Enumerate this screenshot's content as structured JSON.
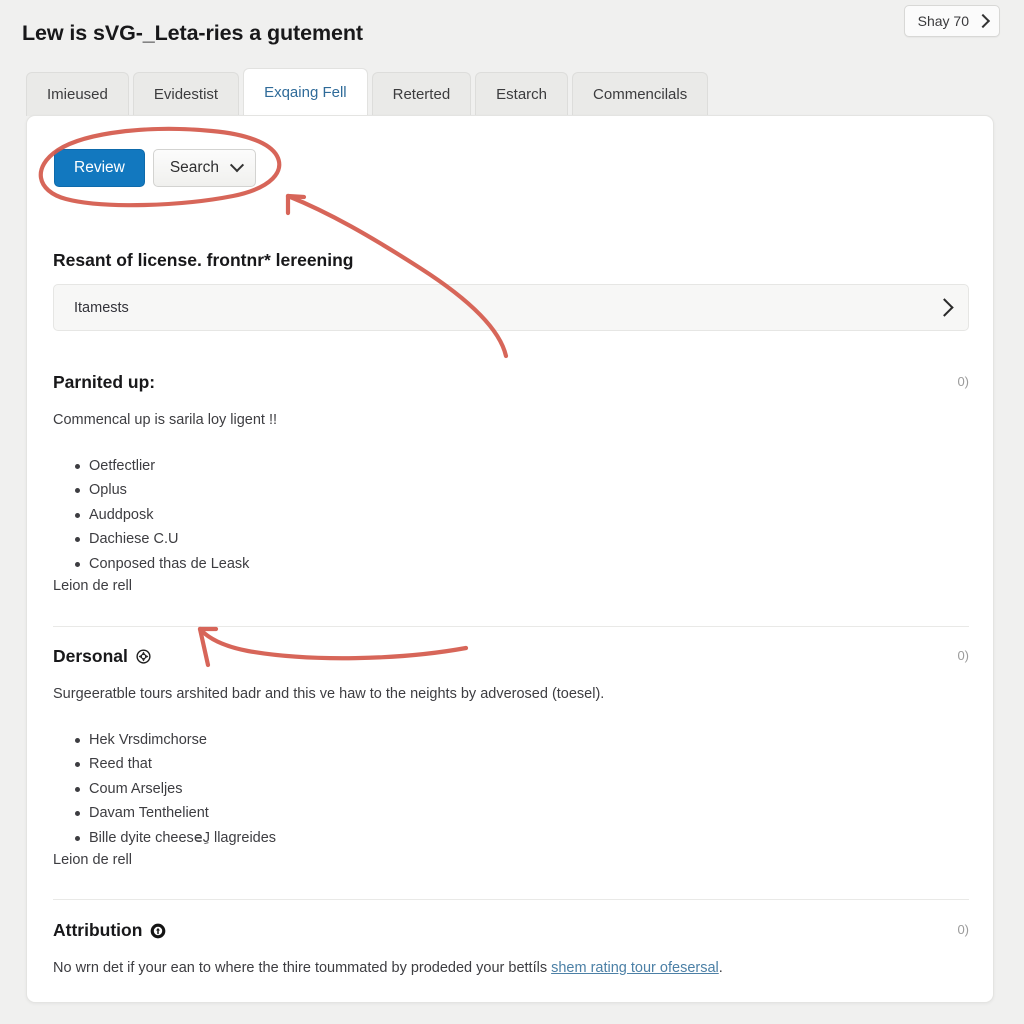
{
  "header": {
    "title": "Lew is sVG-_Leta‑ries a gutement",
    "account_button": {
      "label": "Shay 70",
      "icon": "chevron-right-icon"
    }
  },
  "tabs": [
    {
      "label": "Imieused",
      "active": false,
      "underlined": true
    },
    {
      "label": "Evidestist",
      "active": false,
      "underlined": false
    },
    {
      "label": "Exqaing Fell",
      "active": true,
      "underlined": false
    },
    {
      "label": "Reterted",
      "active": false,
      "underlined": false
    },
    {
      "label": "Estarch",
      "active": false,
      "underlined": false
    },
    {
      "label": "Commencilals",
      "active": false,
      "underlined": false
    }
  ],
  "toolbar": {
    "primary_label": "Review",
    "dropdown_label": "Search",
    "dropdown_icon": "chevron-down-icon"
  },
  "sections": {
    "results": {
      "heading": "Resant of license. frontnr* lereening",
      "row_label": "Itamests",
      "row_icon": "chevron-right-icon"
    },
    "partnered": {
      "heading": "Parnited up:",
      "count": "0)",
      "intro": "Commencal up is sarila loy ligent !!",
      "items": [
        "Oetfectlier",
        "Oplus",
        "Auddposk",
        "Dachiese C.U",
        "Conposed thas de Leask"
      ],
      "footer": "Leion de rell"
    },
    "personal": {
      "heading": "Dersonal",
      "heading_icon": "gear-icon",
      "count": "0)",
      "intro": "Surgeeratble tours arshited badr and this ve haw to the neights by adverosed (toesel).",
      "items": [
        "Hek Vrsdimchorse",
        "Reed that",
        "Coum Arseljes",
        "Davam Tenthelient",
        "Bille dyite cheeseِJ llagreides"
      ],
      "footer": "Leion de rell"
    },
    "attribution": {
      "heading": "Attribution",
      "heading_icon": "info-circle-icon",
      "count": "0)",
      "text_before": "No wrn det if your ean to where the thire toummated by prodeded your bettíls ",
      "link_text": "shem rating tour ofesersal",
      "text_after": "."
    }
  },
  "annotations": {
    "color": "#d4594b",
    "shapes": [
      "ellipse-around-toolbar",
      "arrow-to-toolbar",
      "arrow-to-personal-heading"
    ]
  }
}
